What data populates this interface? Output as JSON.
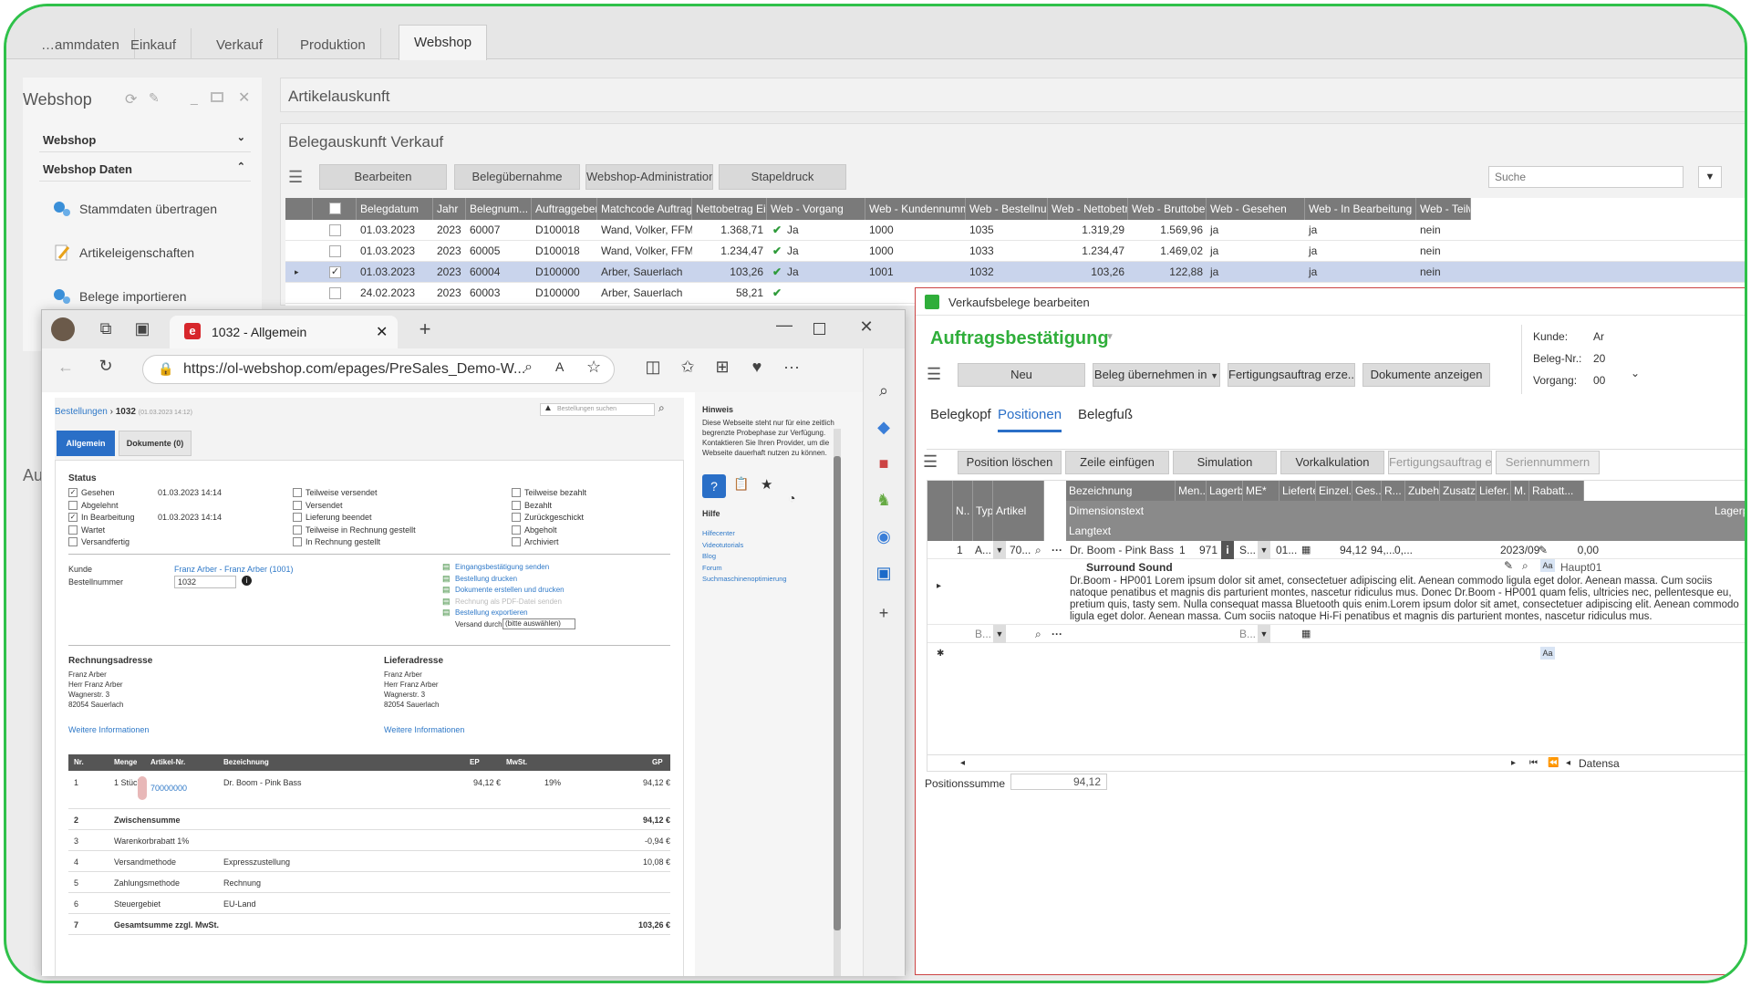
{
  "tabs": [
    "…ammdaten",
    "Einkauf",
    "Verkauf",
    "Produktion",
    "Webshop"
  ],
  "sidebar": {
    "title": "Webshop",
    "section1": "Webshop",
    "section2": "Webshop Daten",
    "items": [
      "Stammdaten übertragen",
      "Artikeleigenschaften",
      "Belege importieren"
    ]
  },
  "artikel_title": "Artikelauskunft",
  "beleg": {
    "title": "Belegauskunft Verkauf",
    "buttons": [
      "Bearbeiten",
      "Belegübernahme",
      "Webshop-Administration",
      "Stapeldruck"
    ],
    "search_placeholder": "Suche",
    "columns": [
      "Belegdatum",
      "Jahr",
      "Belegnum...",
      "Auftraggeber",
      "Matchcode Auftragg...",
      "Nettobetrag Ei...",
      "Web - Vorgang",
      "Web - Kundennummer",
      "Web - Bestellnu...",
      "Web - Nettobetr...",
      "Web - Bruttobetr...",
      "Web - Gesehen",
      "Web - In Bearbeitung",
      "Web - Teilw..."
    ],
    "rows": [
      [
        "01.03.2023",
        "2023",
        "60007",
        "D100018",
        "Wand, Volker, FFM",
        "1.368,71",
        "Ja",
        "1000",
        "1035",
        "1.319,29",
        "1.569,96",
        "ja",
        "ja",
        "nein"
      ],
      [
        "01.03.2023",
        "2023",
        "60005",
        "D100018",
        "Wand, Volker, FFM",
        "1.234,47",
        "Ja",
        "1000",
        "1033",
        "1.234,47",
        "1.469,02",
        "ja",
        "ja",
        "nein"
      ],
      [
        "01.03.2023",
        "2023",
        "60004",
        "D100000",
        "Arber, Sauerlach",
        "103,26",
        "Ja",
        "1001",
        "1032",
        "103,26",
        "122,88",
        "ja",
        "ja",
        "nein"
      ],
      [
        "24.02.2023",
        "2023",
        "60003",
        "D100000",
        "Arber, Sauerlach",
        "58,21",
        "",
        "",
        "",
        "",
        "",
        "",
        "",
        ""
      ]
    ]
  },
  "side_label": "Au",
  "browser": {
    "tab_title": "1032 - Allgemein",
    "url": "https://ol-webshop.com/epages/PreSales_Demo-W...",
    "breadcrumb": "Bestellungen",
    "order_no": "1032",
    "order_date": "(01.03.2023 14:12)",
    "search_placeholder": "Bestellungen suchen",
    "tab_allgemein": "Allgemein",
    "tab_dokumente": "Dokumente (0)",
    "status_title": "Status",
    "status_col1": [
      "Gesehen",
      "Abgelehnt",
      "In Bearbeitung",
      "Wartet",
      "Versandfertig"
    ],
    "status_col1_dates": [
      "01.03.2023 14:14",
      "",
      "01.03.2023 14:14",
      "",
      ""
    ],
    "status_col2": [
      "Teilweise versendet",
      "Versendet",
      "Lieferung beendet",
      "Teilweise in Rechnung gestellt",
      "In Rechnung gestellt"
    ],
    "status_col3": [
      "Teilweise bezahlt",
      "Bezahlt",
      "Zurückgeschickt",
      "Abgeholt",
      "Archiviert"
    ],
    "kunde_label": "Kunde",
    "kunde_value": "Franz Arber - Franz Arber (1001)",
    "bestellnummer_label": "Bestellnummer",
    "bestellnummer_value": "1032",
    "actions": [
      "Eingangsbestätigung senden",
      "Bestellung drucken",
      "Dokumente erstellen und drucken",
      "Rechnung als PDF-Datei senden",
      "Bestellung exportieren"
    ],
    "versand_label": "Versand durch",
    "versand_value": "(bitte auswählen)",
    "rechnung_title": "Rechnungsadresse",
    "liefer_title": "Lieferadresse",
    "address": [
      "Franz Arber",
      "Herr Franz Arber",
      "Wagnerstr. 3",
      "82054 Sauerlach"
    ],
    "more_info": "Weitere Informationen",
    "order_cols": [
      "Nr.",
      "Menge",
      "Artikel-Nr.",
      "Bezeichnung",
      "EP",
      "MwSt.",
      "GP"
    ],
    "order_rows": [
      [
        "1",
        "1 Stück",
        "70000000",
        "Dr. Boom - Pink Bass",
        "94,12 €",
        "19%",
        "94,12 €"
      ],
      [
        "2",
        "Zwischensumme",
        "",
        "",
        "",
        "",
        "94,12 €"
      ],
      [
        "3",
        "Warenkorbrabatt 1%",
        "",
        "",
        "",
        "",
        "-0,94 €"
      ],
      [
        "4",
        "Versandmethode",
        "",
        "Expresszustellung",
        "",
        "",
        "10,08 €"
      ],
      [
        "5",
        "Zahlungsmethode",
        "",
        "Rechnung",
        "",
        "",
        ""
      ],
      [
        "6",
        "Steuergebiet",
        "",
        "EU-Land",
        "",
        "",
        ""
      ],
      [
        "7",
        "Gesamtsumme zzgl. MwSt.",
        "",
        "",
        "",
        "",
        "103,26 €"
      ]
    ],
    "hint_title": "Hinweis",
    "hint_text": "Diese Webseite steht nur für eine zeitlich begrenzte Probephase zur Verfügung. Kontaktieren Sie Ihren Provider, um die Webseite dauerhaft nutzen zu können.",
    "help_title": "Hilfe",
    "help_links": [
      "Hilfecenter",
      "Videotutorials",
      "Blog",
      "Forum",
      "Suchmaschinenoptimierung"
    ]
  },
  "dialog": {
    "title": "Verkaufsbelege bearbeiten",
    "heading": "Auftragsbestätigung",
    "buttons": [
      "Neu",
      "Beleg übernehmen in",
      "Fertigungsauftrag erze...",
      "Dokumente anzeigen"
    ],
    "kunde_label": "Kunde:",
    "kunde_value": "Ar",
    "belegnr_label": "Beleg-Nr.:",
    "belegnr_value": "20",
    "vorgang_label": "Vorgang:",
    "vorgang_value": "00",
    "tabs": [
      "Belegkopf",
      "Positionen",
      "Belegfuß"
    ],
    "pos_buttons": [
      "Position löschen",
      "Zeile einfügen",
      "Simulation",
      "Vorkalkulation",
      "Fertigungsauftrag erze...",
      "Seriennummern"
    ],
    "cols": [
      "N..",
      "Typ*",
      "Artikel",
      "Bezeichnung",
      "Men...",
      "Lagerbes...",
      "ME*",
      "Lieferte...",
      "Einzel...",
      "Ges...",
      "R...",
      "Zubehö...",
      "Zusatz...",
      "Liefer...",
      "M.",
      "Rabatt..."
    ],
    "sub_headers": [
      "Dimensionstext",
      "Langtext",
      "Lagerplä"
    ],
    "row": {
      "nr": "1",
      "typ": "A...",
      "artikel": "70...",
      "bez": "Dr. Boom - Pink Bass",
      "menge": "1",
      "lager": "971",
      "me": "S...",
      "liefer": "01...",
      "einzel": "94,12",
      "ges": "94,...",
      "r": "0,...",
      "period": "2023/09",
      "rabatt": "0,00",
      "lagerplatz": "Haupt01"
    },
    "dimension": "Surround Sound",
    "langtext": "Dr.Boom - HP001 Lorem ipsum dolor sit amet, consectetuer adipiscing elit. Aenean commodo ligula eget dolor. Aenean massa. Cum sociis natoque penatibus et magnis dis parturient montes, nascetur ridiculus mus. Donec Dr.Boom - HP001 quam felis, ultricies nec, pellentesque eu, pretium quis, tasty sem. Nulla consequat massa Bluetooth quis enim.Lorem ipsum dolor sit amet, consectetuer adipiscing elit. Aenean commodo ligula eget dolor. Aenean massa. Cum sociis natoque Hi-Fi penatibus et magnis dis parturient montes, nascetur ridiculus mus.",
    "row2_typ": "B...",
    "row2_me": "B...",
    "nav_label": "Datensa",
    "positionssumme_label": "Positionssumme",
    "positionssumme_value": "94,12"
  }
}
